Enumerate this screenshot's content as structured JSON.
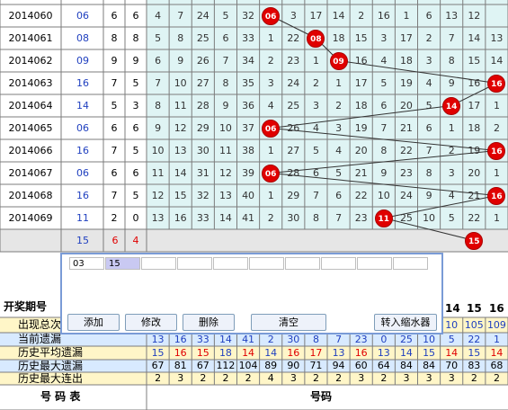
{
  "rows": [
    {
      "issue": "2014060",
      "num": "06",
      "a": "6",
      "b": "6",
      "cells": [
        "4",
        "7",
        "24",
        "5",
        "32",
        "06",
        "3",
        "17",
        "14",
        "2",
        "16",
        "1",
        "6",
        "13",
        "12"
      ]
    },
    {
      "issue": "2014061",
      "num": "08",
      "a": "8",
      "b": "8",
      "cells": [
        "5",
        "8",
        "25",
        "6",
        "33",
        "1",
        "22",
        "08",
        "18",
        "15",
        "3",
        "17",
        "2",
        "7",
        "14",
        "13"
      ]
    },
    {
      "issue": "2014062",
      "num": "09",
      "a": "9",
      "b": "9",
      "cells": [
        "6",
        "9",
        "26",
        "7",
        "34",
        "2",
        "23",
        "1",
        "09",
        "16",
        "4",
        "18",
        "3",
        "8",
        "15",
        "14"
      ]
    },
    {
      "issue": "2014063",
      "num": "16",
      "a": "7",
      "b": "5",
      "cells": [
        "7",
        "10",
        "27",
        "8",
        "35",
        "3",
        "24",
        "2",
        "1",
        "17",
        "5",
        "19",
        "4",
        "9",
        "16",
        "16"
      ]
    },
    {
      "issue": "2014064",
      "num": "14",
      "a": "5",
      "b": "3",
      "cells": [
        "8",
        "11",
        "28",
        "9",
        "36",
        "4",
        "25",
        "3",
        "2",
        "18",
        "6",
        "20",
        "5",
        "14",
        "17",
        "1"
      ]
    },
    {
      "issue": "2014065",
      "num": "06",
      "a": "6",
      "b": "6",
      "cells": [
        "9",
        "12",
        "29",
        "10",
        "37",
        "06",
        "26",
        "4",
        "3",
        "19",
        "7",
        "21",
        "6",
        "1",
        "18",
        "2"
      ]
    },
    {
      "issue": "2014066",
      "num": "16",
      "a": "7",
      "b": "5",
      "cells": [
        "10",
        "13",
        "30",
        "11",
        "38",
        "1",
        "27",
        "5",
        "4",
        "20",
        "8",
        "22",
        "7",
        "2",
        "19",
        "16"
      ]
    },
    {
      "issue": "2014067",
      "num": "06",
      "a": "6",
      "b": "6",
      "cells": [
        "11",
        "14",
        "31",
        "12",
        "39",
        "06",
        "28",
        "6",
        "5",
        "21",
        "9",
        "23",
        "8",
        "3",
        "20",
        "1"
      ]
    },
    {
      "issue": "2014068",
      "num": "16",
      "a": "7",
      "b": "5",
      "cells": [
        "12",
        "15",
        "32",
        "13",
        "40",
        "1",
        "29",
        "7",
        "6",
        "22",
        "10",
        "24",
        "9",
        "4",
        "21",
        "16"
      ]
    },
    {
      "issue": "2014069",
      "num": "11",
      "a": "2",
      "b": "0",
      "cells": [
        "13",
        "16",
        "33",
        "14",
        "41",
        "2",
        "30",
        "8",
        "7",
        "23",
        "11",
        "25",
        "10",
        "5",
        "22",
        "1"
      ]
    }
  ],
  "summary": {
    "num": "15",
    "a": "6",
    "b": "4"
  },
  "dialog": {
    "entries": [
      "03",
      "15",
      "",
      "",
      "",
      "",
      "",
      "",
      "",
      ""
    ],
    "buttons": {
      "add": "添加",
      "edit": "修改",
      "delete": "删除",
      "clear": "清空",
      "transfer": "转入缩水器"
    }
  },
  "header_label": "开奖期号",
  "header_cols": [
    "14",
    "15",
    "16"
  ],
  "stats": [
    {
      "label": "出现总次数",
      "values": [
        "10",
        "105",
        "109"
      ]
    },
    {
      "label": "当前遗漏",
      "values": [
        "13",
        "16",
        "33",
        "14",
        "41",
        "2",
        "30",
        "8",
        "7",
        "23",
        "0",
        "25",
        "10",
        "5",
        "22",
        "1"
      ]
    },
    {
      "label": "历史平均遗漏",
      "values": [
        "15",
        "16",
        "15",
        "18",
        "14",
        "14",
        "16",
        "17",
        "13",
        "16",
        "13",
        "14",
        "15",
        "14",
        "15",
        "14"
      ]
    },
    {
      "label": "历史最大遗漏",
      "values": [
        "67",
        "81",
        "67",
        "112",
        "104",
        "89",
        "90",
        "71",
        "94",
        "60",
        "64",
        "84",
        "84",
        "70",
        "83",
        "68"
      ]
    },
    {
      "label": "历史最大连出",
      "values": [
        "2",
        "3",
        "2",
        "2",
        "2",
        "4",
        "3",
        "2",
        "2",
        "3",
        "2",
        "3",
        "3",
        "3",
        "2",
        "2"
      ]
    }
  ],
  "footer": {
    "left": "号 码 表",
    "right": "号码"
  }
}
